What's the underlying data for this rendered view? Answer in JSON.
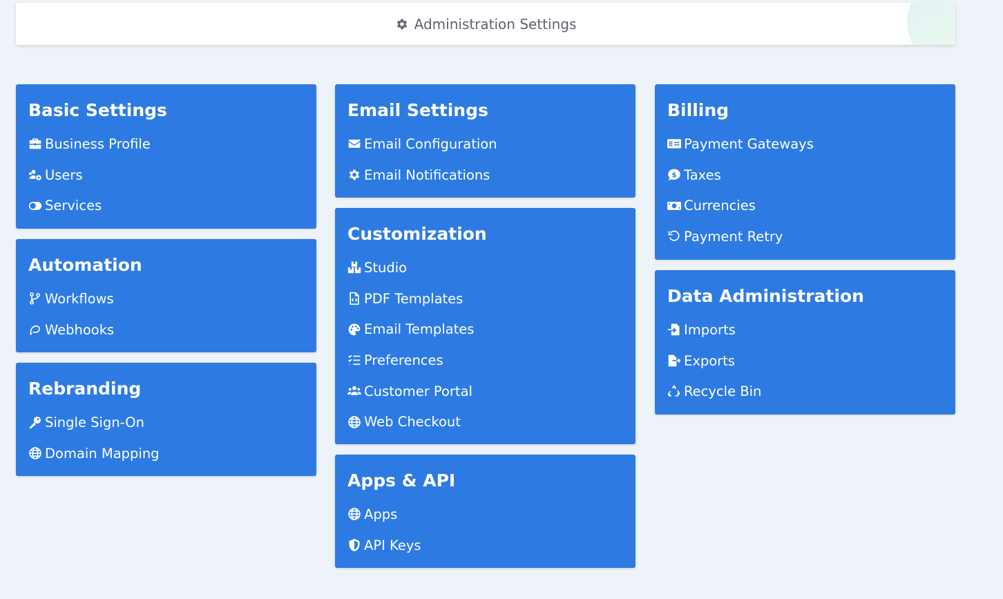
{
  "header": {
    "title": "Administration Settings",
    "icon": "gear-icon"
  },
  "sections": {
    "basic": {
      "title": "Basic Settings",
      "items": [
        {
          "label": "Business Profile",
          "icon": "briefcase-icon"
        },
        {
          "label": "Users",
          "icon": "users-gear-icon"
        },
        {
          "label": "Services",
          "icon": "toggle-icon"
        }
      ]
    },
    "automation": {
      "title": "Automation",
      "items": [
        {
          "label": "Workflows",
          "icon": "code-branch-icon"
        },
        {
          "label": "Webhooks",
          "icon": "loop-icon"
        }
      ]
    },
    "rebranding": {
      "title": "Rebranding",
      "items": [
        {
          "label": "Single Sign-On",
          "icon": "key-icon"
        },
        {
          "label": "Domain Mapping",
          "icon": "globe-icon"
        }
      ]
    },
    "email": {
      "title": "Email Settings",
      "items": [
        {
          "label": "Email Configuration",
          "icon": "envelope-icon"
        },
        {
          "label": "Email Notifications",
          "icon": "gear-icon"
        }
      ]
    },
    "customization": {
      "title": "Customization",
      "items": [
        {
          "label": "Studio",
          "icon": "cubes-icon"
        },
        {
          "label": "PDF Templates",
          "icon": "file-code-icon"
        },
        {
          "label": "Email Templates",
          "icon": "palette-icon"
        },
        {
          "label": "Preferences",
          "icon": "list-check-icon"
        },
        {
          "label": "Customer Portal",
          "icon": "users-icon"
        },
        {
          "label": "Web Checkout",
          "icon": "globe-icon"
        }
      ]
    },
    "apps": {
      "title": "Apps & API",
      "items": [
        {
          "label": "Apps",
          "icon": "globe-icon"
        },
        {
          "label": "API Keys",
          "icon": "shield-icon"
        }
      ]
    },
    "billing": {
      "title": "Billing",
      "items": [
        {
          "label": "Payment Gateways",
          "icon": "money-check-icon"
        },
        {
          "label": "Taxes",
          "icon": "dollar-comment-icon"
        },
        {
          "label": "Currencies",
          "icon": "money-bill-icon"
        },
        {
          "label": "Payment Retry",
          "icon": "rotate-left-icon"
        }
      ]
    },
    "data": {
      "title": "Data Administration",
      "items": [
        {
          "label": "Imports",
          "icon": "file-import-icon"
        },
        {
          "label": "Exports",
          "icon": "file-export-icon"
        },
        {
          "label": "Recycle Bin",
          "icon": "recycle-icon"
        }
      ]
    }
  },
  "colors": {
    "card": "#2d7be2",
    "background": "#eef2f9",
    "header_text": "#5b6270"
  }
}
